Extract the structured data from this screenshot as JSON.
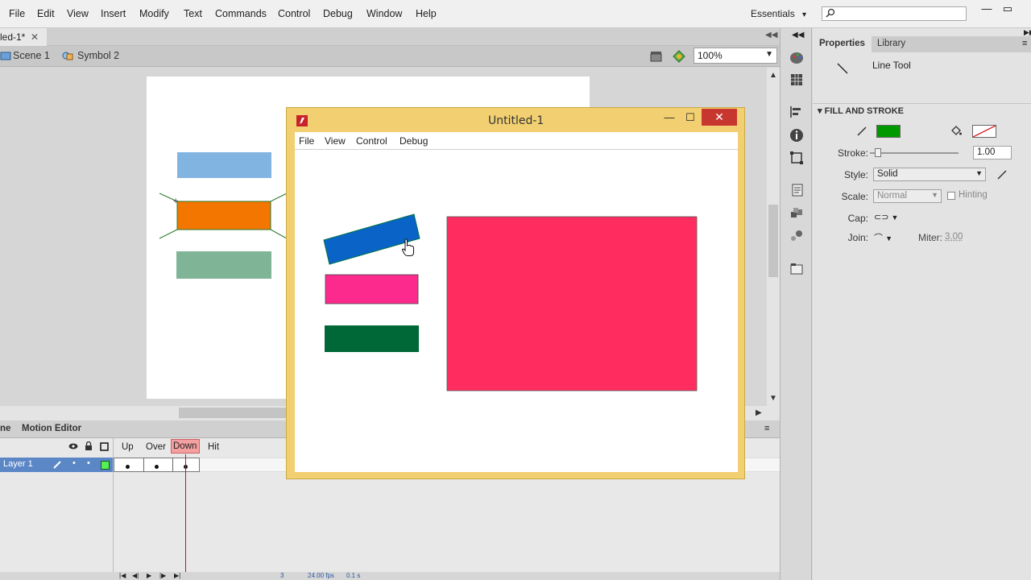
{
  "menubar": {
    "items": [
      "File",
      "Edit",
      "View",
      "Insert",
      "Modify",
      "Text",
      "Commands",
      "Control",
      "Debug",
      "Window",
      "Help"
    ],
    "workspace": "Essentials",
    "workspace_arrow": "▾",
    "search_placeholder": ""
  },
  "document": {
    "tab_label": "led-1*",
    "tab_close": "✕",
    "breadcrumbs": [
      "Scene 1",
      "Symbol 2"
    ],
    "zoom": "100%"
  },
  "timeline": {
    "tabs": [
      "ne",
      "Motion Editor"
    ],
    "frame_labels": [
      "Up",
      "Over",
      "Down",
      "Hit"
    ],
    "active_frame": "Down",
    "layer_name": "Layer 1",
    "status": {
      "frame": "3",
      "fps": "24.00 fps",
      "time": "0.1 s"
    }
  },
  "properties": {
    "tabs": [
      "Properties",
      "Library"
    ],
    "active_tab": "Properties",
    "tool_name": "Line Tool",
    "section": "FILL AND STROKE",
    "stroke_label": "Stroke:",
    "stroke_value": "1.00",
    "style_label": "Style:",
    "style_value": "Solid",
    "scale_label": "Scale:",
    "scale_value": "Normal",
    "hinting_label": "Hinting",
    "cap_label": "Cap:",
    "join_label": "Join:",
    "miter_label": "Miter:",
    "miter_value": "3.00",
    "stroke_color": "#009a00",
    "fill_color": "none"
  },
  "swf_window": {
    "title": "Untitled-1",
    "menu": [
      "File",
      "View",
      "Control",
      "Debug"
    ],
    "min": "—",
    "max": "☐",
    "close": "✕"
  },
  "colors": {
    "button_up": "#82b4e2",
    "button_over": "#f27600",
    "button_hit": "#80b496",
    "rotated_blue": "#0a64c8",
    "pink_small": "#fd2a8e",
    "dark_green": "#006837",
    "big_pink": "#ff2d5f",
    "swf_frame": "#f2d071"
  }
}
